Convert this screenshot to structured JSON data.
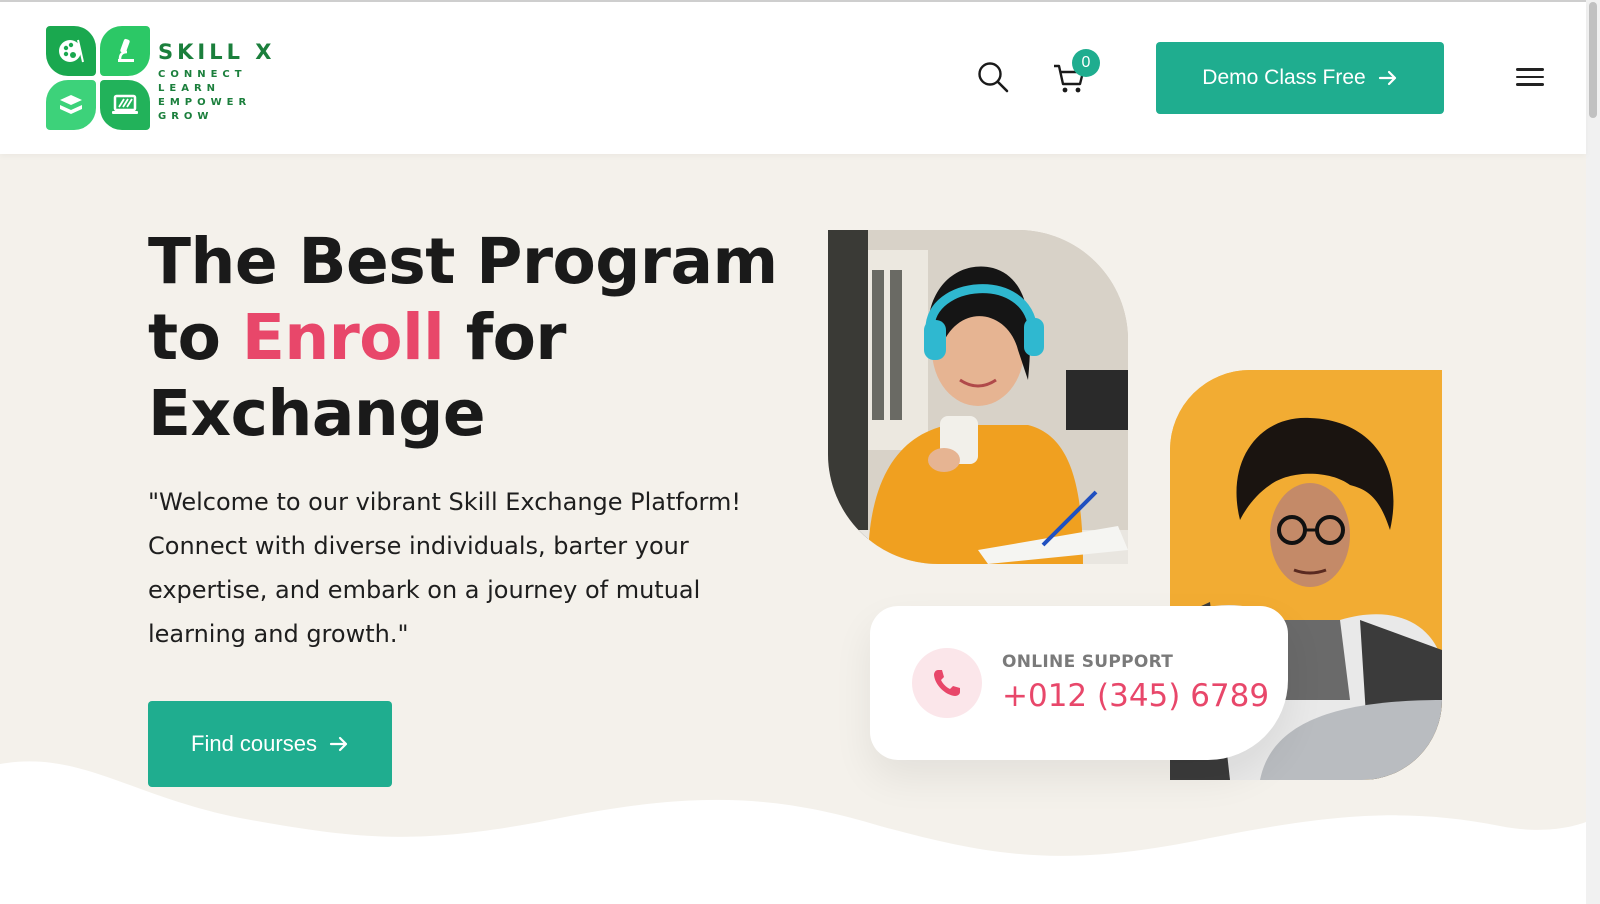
{
  "brand": {
    "name": "SKILL X",
    "tagline": [
      "CONNECT",
      "LEARN",
      "EMPOWER",
      "GROW"
    ],
    "colors": {
      "primary": "#1fad8f",
      "logo_green": "#1b7f3c",
      "accent": "#e8476a",
      "hero_bg": "#f4f1eb"
    }
  },
  "header": {
    "search_icon": "search-icon",
    "cart_icon": "cart-icon",
    "cart_count": "0",
    "demo_button": "Demo Class Free",
    "menu_icon": "hamburger-menu-icon"
  },
  "hero": {
    "title_line1": "The Best Program",
    "title_pre": "to",
    "title_accent": "Enroll",
    "title_post": "for",
    "title_line3": "Exchange",
    "intro": "\"Welcome to our vibrant Skill Exchange Platform! Connect with diverse individuals, barter your expertise, and embark on a journey of mutual learning and growth.\"",
    "cta": "Find courses"
  },
  "support": {
    "label": "ONLINE SUPPORT",
    "phone": "+012 (345) 6789"
  }
}
